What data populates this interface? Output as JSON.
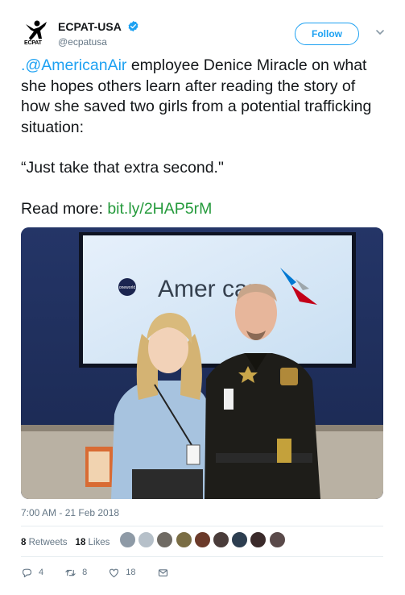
{
  "account": {
    "display_name": "ECPAT-USA",
    "handle": "@ecpatusa",
    "logo_text": "ECPAT"
  },
  "follow_label": "Follow",
  "tweet": {
    "mention": ".@AmericanAir",
    "body": " employee Denice Miracle on what she hopes others learn after reading the story of how she saved two girls from a potential trafficking situation:",
    "quote": "“Just take that extra second.\"",
    "read_more_label": "Read more: ",
    "link_text": "bit.ly/2HAP5rM"
  },
  "photo": {
    "sign_text": "Amer  can",
    "oneworld_text": "oneworld"
  },
  "timestamp": "7:00 AM - 21 Feb 2018",
  "stats": {
    "retweets_count": "8",
    "retweets_label": "Retweets",
    "likes_count": "18",
    "likes_label": "Likes"
  },
  "avatar_colors": [
    "#8e9aa6",
    "#b6c0c9",
    "#6f6a63",
    "#7a6d44",
    "#6b3a2a",
    "#4a3c3a",
    "#2d3e50",
    "#3a2a2a",
    "#5a4a4a"
  ],
  "actions": {
    "reply_count": "4",
    "retweet_count": "8",
    "like_count": "18"
  },
  "colors": {
    "accent": "#1da1f2",
    "link_green": "#249a3b",
    "secondary_text": "#657786"
  }
}
